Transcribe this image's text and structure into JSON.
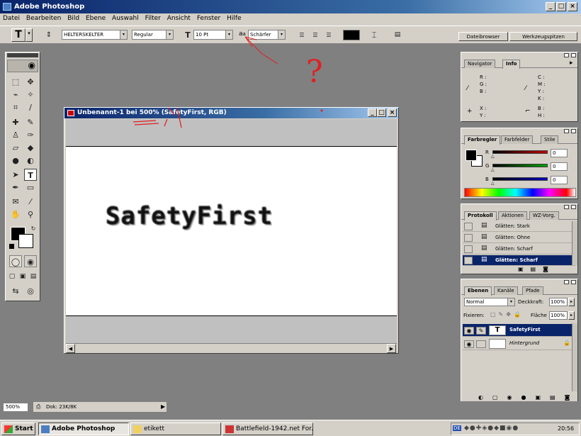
{
  "app": {
    "title": "Adobe Photoshop"
  },
  "menu": [
    "Datei",
    "Bearbeiten",
    "Bild",
    "Ebene",
    "Auswahl",
    "Filter",
    "Ansicht",
    "Fenster",
    "Hilfe"
  ],
  "options": {
    "font_family": "HELTERSKELTER",
    "font_style": "Regular",
    "font_size": "10 Pt",
    "aa_label": "a",
    "aa_label2": "a",
    "antialias": "Schärfer",
    "file_browser": "Dateibrowser",
    "tool_presets": "Werkzeugspitzen"
  },
  "document": {
    "title": "Unbenannt-1 bei 500% (SafetyFirst, RGB)",
    "canvas_text": "SafetyFirst"
  },
  "status": {
    "zoom": "500%",
    "doc": "Dok: 23K/8K"
  },
  "navigator": {
    "tabs": [
      "Navigator",
      "Info"
    ],
    "rgb_labels": [
      "R :",
      "G :",
      "B :"
    ],
    "cmyk_labels": [
      "C :",
      "M :",
      "Y :",
      "K :"
    ],
    "xy_labels": [
      "X :",
      "Y :"
    ],
    "bh_labels": [
      "B :",
      "H :"
    ]
  },
  "color": {
    "tabs": [
      "Farbregler",
      "Farbfelder",
      "Stile"
    ],
    "channels": [
      {
        "label": "R",
        "value": "0",
        "color": "#c00000"
      },
      {
        "label": "G",
        "value": "0",
        "color": "#00a000"
      },
      {
        "label": "B",
        "value": "0",
        "color": "#0000c0"
      }
    ]
  },
  "history": {
    "tabs": [
      "Protokoll",
      "Aktionen",
      "WZ-Vorg."
    ],
    "items": [
      "Glätten: Stark",
      "Glätten: Ohne",
      "Glätten: Scharf",
      "Glätten: Scharf"
    ],
    "selected_index": 3
  },
  "layers": {
    "tabs": [
      "Ebenen",
      "Kanäle",
      "Pfade"
    ],
    "blend_mode": "Normal",
    "opacity_label": "Deckkraft:",
    "opacity": "100%",
    "lock_label": "Fixieren:",
    "fill_label": "Fläche",
    "fill": "100%",
    "items": [
      {
        "name": "SafetyFirst",
        "type": "T",
        "selected": true
      },
      {
        "name": "Hintergrund",
        "type": "bg",
        "selected": false
      }
    ]
  },
  "taskbar": {
    "start": "Start",
    "buttons": [
      "Adobe Photoshop",
      "etikett",
      "Battlefield-1942.net For..."
    ],
    "clock": "20:56",
    "lang": "DE"
  },
  "annotation": {
    "mark": "?"
  }
}
